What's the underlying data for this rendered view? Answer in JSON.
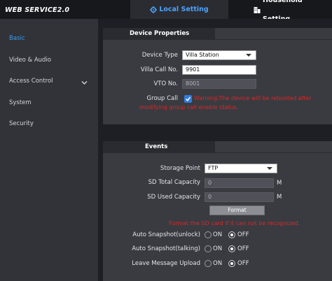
{
  "header": {
    "logo": "WEB SERVICE2.0",
    "tabs": [
      {
        "label": "Local Setting",
        "icon": "gear-icon",
        "active": true
      },
      {
        "label": "Household Setting",
        "icon": "building-icon",
        "active": false
      }
    ]
  },
  "sidebar": {
    "items": [
      {
        "label": "Basic",
        "active": true
      },
      {
        "label": "Video & Audio",
        "active": false
      },
      {
        "label": "Access Control",
        "active": false,
        "expandable": true
      },
      {
        "label": "System",
        "active": false
      },
      {
        "label": "Security",
        "active": false
      }
    ]
  },
  "device": {
    "title": "Device Properties",
    "device_type_label": "Device Type",
    "device_type_value": "Villa Station",
    "villa_call_label": "Villa Call No.",
    "villa_call_value": "9901",
    "vto_label": "VTO No.",
    "vto_value": "8001",
    "group_call_label": "Group Call",
    "group_call_checked": true,
    "group_call_warning_1": "Warning:The device will be rebooted after",
    "group_call_warning_2": "modifying group call enable status."
  },
  "events": {
    "title": "Events",
    "storage_label": "Storage Point",
    "storage_value": "FTP",
    "sd_total_label": "SD Total Capacity",
    "sd_total_value": "0",
    "sd_total_unit": "M",
    "sd_used_label": "SD Used Capacity",
    "sd_used_value": "0",
    "sd_used_unit": "M",
    "format_button": "Format",
    "format_warning": "Format the SD card if it can not be recognized.",
    "snap_unlock_label": "Auto Snapshot(unlock)",
    "snap_talking_label": "Auto Snapshot(talking)",
    "leave_msg_label": "Leave Message Upload",
    "on_label": "ON",
    "off_label": "OFF",
    "snap_unlock_value": "OFF",
    "snap_talking_value": "OFF",
    "leave_msg_value": "OFF"
  },
  "colors": {
    "accent": "#3d9cf0",
    "warning": "#d42a2a",
    "panel": "#3a3b41",
    "topbar": "#17181c"
  }
}
